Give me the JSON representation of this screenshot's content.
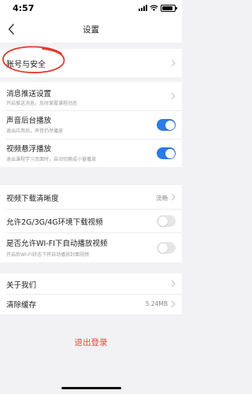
{
  "status_bar": {
    "time": "4:57"
  },
  "nav": {
    "title": "设置"
  },
  "account": {
    "label": "账号与安全"
  },
  "push_settings": {
    "label": "消息推送设置",
    "sub": "开启推送消息，及时掌握课程动态"
  },
  "background_audio": {
    "label": "声音后台播放",
    "sub": "退出应用后，声音仍然播放",
    "enabled": true
  },
  "floating_video": {
    "label": "视频悬浮播放",
    "sub": "退出课程学习页面时，自动切换成小窗播放",
    "enabled": true
  },
  "download_quality": {
    "label": "视频下载清晰度",
    "value": "流畅"
  },
  "mobile_download": {
    "label": "允许2G/3G/4G环境下载视频",
    "enabled": false
  },
  "wifi_autoplay": {
    "label": "是否允许WI-FI下自动播放视频",
    "sub": "开启后WI-FI状态下将自动播放封面视频",
    "enabled": false
  },
  "about": {
    "label": "关于我们"
  },
  "cache": {
    "label": "清除缓存",
    "value": "5.24MB"
  },
  "logout": {
    "label": "退出登录"
  },
  "colors": {
    "accent": "#2a7be7",
    "logout": "#e8473a",
    "annotation": "#e23a2c",
    "background": "#f2f2f4"
  }
}
